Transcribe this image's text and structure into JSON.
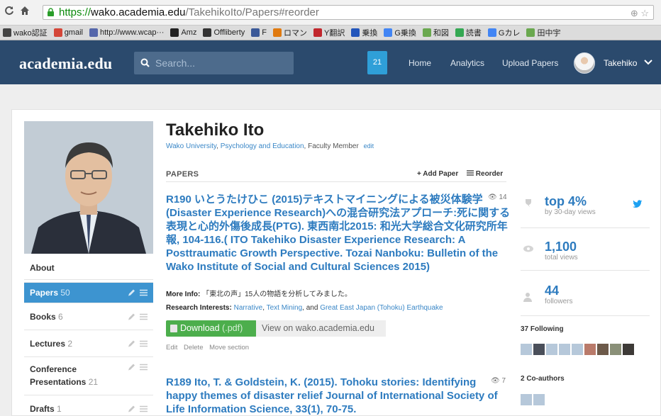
{
  "browser": {
    "url_https": "https://",
    "url_host": "wako.academia.edu",
    "url_path": "/TakehikoIto/Papers#reorder",
    "bookmarks": [
      {
        "label": "wako認証",
        "color": "#444"
      },
      {
        "label": "gmail",
        "color": "#d44638"
      },
      {
        "label": "http://www.wcap···",
        "color": "#5566aa"
      },
      {
        "label": "Amz",
        "color": "#222"
      },
      {
        "label": "Offliberty",
        "color": "#333"
      },
      {
        "label": "F",
        "color": "#3b5998"
      },
      {
        "label": "ロマン",
        "color": "#e07a10"
      },
      {
        "label": "Y翻訳",
        "color": "#c1272d"
      },
      {
        "label": "乗換",
        "color": "#2255bb"
      },
      {
        "label": "G乗換",
        "color": "#4285f4"
      },
      {
        "label": "和図",
        "color": "#6aa84f"
      },
      {
        "label": "読書",
        "color": "#34a853"
      },
      {
        "label": "Gカレ",
        "color": "#4285f4"
      },
      {
        "label": "田中宇",
        "color": "#6aa84f"
      }
    ]
  },
  "header": {
    "logo": "academia.edu",
    "search_placeholder": "Search...",
    "notifications": "21",
    "nav": [
      "Home",
      "Analytics",
      "Upload Papers"
    ],
    "user": "Takehiko"
  },
  "profile": {
    "name": "Takehiko Ito",
    "university": "Wako University",
    "department": "Psychology and Education",
    "role": ", Faculty Member",
    "edit": "edit"
  },
  "sidebar": {
    "about": "About",
    "items": [
      {
        "label": "Papers",
        "count": "50"
      },
      {
        "label": "Books",
        "count": "6"
      },
      {
        "label": "Lectures",
        "count": "2"
      },
      {
        "label": "Conference",
        "label2": "Presentations",
        "count": "21"
      },
      {
        "label": "Drafts",
        "count": "1"
      }
    ]
  },
  "papers": {
    "heading": "PAPERS",
    "add": "Add Paper",
    "reorder": "Reorder",
    "list": [
      {
        "title_lines": [
          "R190 いとうたけひこ (2015)テキストマイニングによる被災体験学",
          "(Disaster Experience Research)への混合研究法アプローチ:死に関する",
          "表現と心的外傷後成長(PTG). 東西南北2015: 和光大学総合文化研究所年",
          "報, 104-116.( ITO Takehiko Disaster Experience Research: A",
          "Posttraumatic Growth Perspective. Tozai Nanboku: Bulletin of the",
          "Wako Institute of Social and Cultural Sciences 2015)"
        ],
        "views": "14",
        "more_info_label": "More Info:",
        "more_info": "「東北の声」15人の物語を分析してみました。",
        "interests_label": "Research Interests:",
        "interests": [
          "Narrative",
          "Text Mining",
          "Great East Japan (Tohoku) Earthquake"
        ],
        "interests_sep": [
          ", ",
          ", and "
        ],
        "download": "Download",
        "download_ext": "(.pdf)",
        "view_on": "View on wako.academia.edu",
        "actions": [
          "Edit",
          "Delete",
          "Move section"
        ]
      },
      {
        "title_lines": [
          "R189 Ito, T. & Goldstein, K. (2015). Tohoku stories: Identifying",
          "happy themes of disaster relief Journal of International Society of",
          "Life Information Science, 33(1), 70-75."
        ],
        "views": "7"
      }
    ]
  },
  "stats": {
    "rank": "top 4%",
    "rank_sub": "by 30-day views",
    "views": "1,100",
    "views_sub": "total views",
    "followers": "44",
    "followers_sub": "followers",
    "following": "37 Following",
    "coauthors": "2 Co-authors"
  },
  "colors": {
    "header_bg": "#2b4a6d",
    "link_blue": "#2d7bbf",
    "active_blue": "#3d94d0",
    "download_green": "#4cae4c"
  }
}
